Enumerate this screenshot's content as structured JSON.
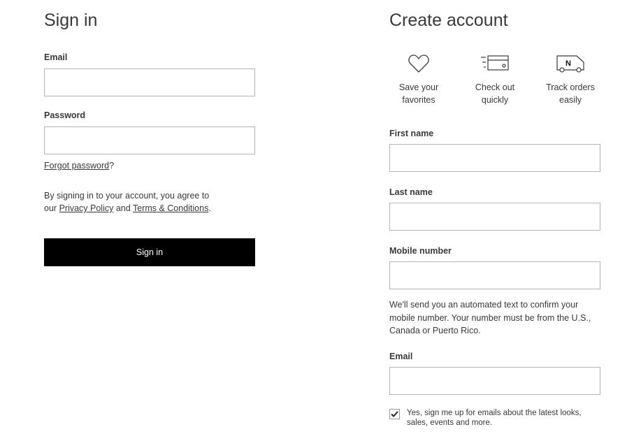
{
  "signin": {
    "title": "Sign in",
    "email_label": "Email",
    "password_label": "Password",
    "forgot": "Forgot password",
    "forgot_q": "?",
    "agree_prefix": "By signing in to your account, you agree to",
    "agree_our": "our",
    "privacy": "Privacy Policy",
    "and": "and",
    "terms": "Terms & Conditions",
    "period": ".",
    "button": "Sign in"
  },
  "create": {
    "title": "Create account",
    "benefits": [
      {
        "icon": "heart-icon",
        "line1": "Save your",
        "line2": "favorites"
      },
      {
        "icon": "credit-card-icon",
        "line1": "Check out",
        "line2": "quickly"
      },
      {
        "icon": "delivery-truck-icon",
        "line1": "Track orders",
        "line2": "easily"
      }
    ],
    "first_name_label": "First name",
    "last_name_label": "Last name",
    "mobile_label": "Mobile number",
    "mobile_note": "We'll send you an automated text to confirm your mobile number. Your number must be from the U.S., Canada or Puerto Rico.",
    "email_label": "Email",
    "newsletter_checked": true,
    "newsletter_line1": "Yes, sign me up for emails about the latest looks,",
    "newsletter_line2": "sales, events and more."
  }
}
